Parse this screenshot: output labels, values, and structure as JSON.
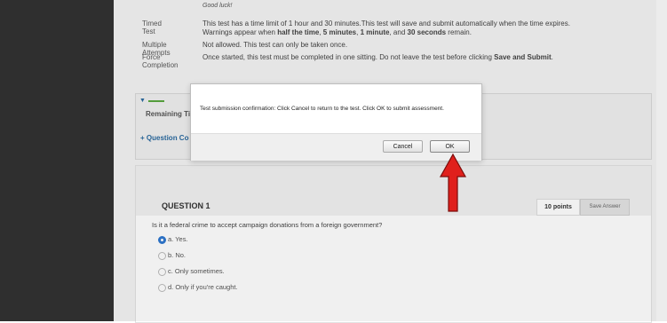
{
  "test_info": {
    "good_luck": "Good luck!",
    "timed_label": "Timed Test",
    "timed_line1": "This test has a time limit of 1 hour and 30 minutes.This test will save and submit automatically when the time expires.",
    "timed_line2_pre": "Warnings appear when ",
    "timed_half": "half the time",
    "timed_comma1": ", ",
    "timed_five": "5 minutes",
    "timed_comma2": ", ",
    "timed_one": "1 minute",
    "timed_and": ", and ",
    "timed_thirty": "30 seconds",
    "timed_remain": " remain.",
    "multiple_label": "Multiple Attempts",
    "multiple_text": "Not allowed. This test can only be taken once.",
    "force_label": "Force Completion",
    "force_text_pre": "Once started, this test must be completed in one sitting. Do not leave the test before clicking ",
    "force_text_bold": "Save and Submit",
    "force_text_post": "."
  },
  "status_panel": {
    "remaining_label": "Remaining Ti",
    "question_completion_label": "Question Co"
  },
  "question": {
    "title": "QUESTION 1",
    "points": "10 points",
    "save_answer_label": "Save Answer",
    "text": "Is it a federal crime to accept campaign donations from a foreign government?",
    "options": [
      {
        "label": "a. Yes.",
        "selected": true
      },
      {
        "label": "b. No.",
        "selected": false
      },
      {
        "label": "c. Only sometimes.",
        "selected": false
      },
      {
        "label": "d. Only if you're caught.",
        "selected": false
      }
    ]
  },
  "dialog": {
    "message": "Test submission confirmation: Click Cancel to return to the test. Click OK to submit assessment.",
    "cancel_label": "Cancel",
    "ok_label": "OK"
  },
  "colors": {
    "arrow_fill": "#e0201c",
    "selected_radio": "#2f78d0",
    "link_blue": "#2a6aa0"
  }
}
